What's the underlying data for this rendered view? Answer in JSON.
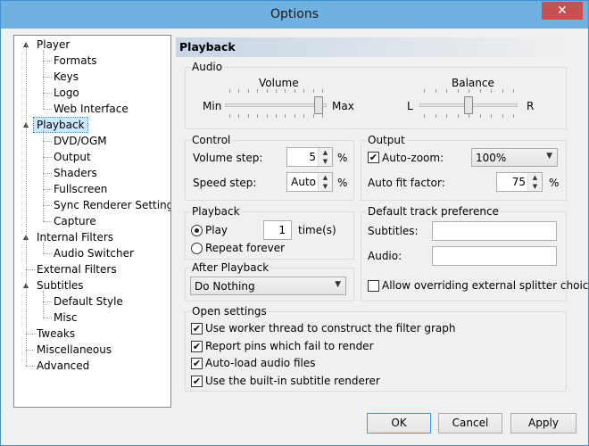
{
  "window": {
    "title": "Options",
    "close_glyph": "✕"
  },
  "tree": [
    {
      "label": "Player",
      "level": 0,
      "toggle": "▲"
    },
    {
      "label": "Formats",
      "level": 1
    },
    {
      "label": "Keys",
      "level": 1
    },
    {
      "label": "Logo",
      "level": 1
    },
    {
      "label": "Web Interface",
      "level": 1
    },
    {
      "label": "Playback",
      "level": 0,
      "toggle": "▲",
      "selected": true
    },
    {
      "label": "DVD/OGM",
      "level": 1
    },
    {
      "label": "Output",
      "level": 1
    },
    {
      "label": "Shaders",
      "level": 1
    },
    {
      "label": "Fullscreen",
      "level": 1
    },
    {
      "label": "Sync Renderer Settings",
      "level": 1
    },
    {
      "label": "Capture",
      "level": 1
    },
    {
      "label": "Internal Filters",
      "level": 0,
      "toggle": "▲"
    },
    {
      "label": "Audio Switcher",
      "level": 1
    },
    {
      "label": "External Filters",
      "level": 0
    },
    {
      "label": "Subtitles",
      "level": 0,
      "toggle": "▲"
    },
    {
      "label": "Default Style",
      "level": 1
    },
    {
      "label": "Misc",
      "level": 1
    },
    {
      "label": "Tweaks",
      "level": 0
    },
    {
      "label": "Miscellaneous",
      "level": 0
    },
    {
      "label": "Advanced",
      "level": 0
    }
  ],
  "page": {
    "title": "Playback"
  },
  "audio": {
    "label": "Audio",
    "volume_label": "Volume",
    "min": "Min",
    "max": "Max",
    "volume_value": 0.96,
    "balance_label": "Balance",
    "left": "L",
    "right": "R",
    "balance_value": 0.5
  },
  "control": {
    "label": "Control",
    "volume_step_label": "Volume step:",
    "volume_step": "5",
    "speed_step_label": "Speed step:",
    "speed_step": "Auto",
    "percent": "%"
  },
  "output": {
    "label": "Output",
    "autozoom_label": "Auto-zoom:",
    "autozoom_checked": true,
    "autozoom_value": "100%",
    "autofit_label": "Auto fit factor:",
    "autofit_value": "75",
    "percent": "%"
  },
  "playback": {
    "label": "Playback",
    "play_label": "Play",
    "play_count": "1",
    "times_label": "time(s)",
    "repeat_label": "Repeat forever"
  },
  "after": {
    "label": "After Playback",
    "value": "Do Nothing"
  },
  "track": {
    "label": "Default track preference",
    "subtitles_label": "Subtitles:",
    "audio_label": "Audio:",
    "allow_label": "Allow overriding external splitter choice"
  },
  "open": {
    "label": "Open settings",
    "items": [
      "Use worker thread to construct the filter graph",
      "Report pins which fail to render",
      "Auto-load audio files",
      "Use the built-in subtitle renderer"
    ]
  },
  "buttons": {
    "ok": "OK",
    "cancel": "Cancel",
    "apply": "Apply"
  },
  "icons": {
    "spin_up": "▲",
    "spin_down": "▼",
    "dropdown": "▼",
    "check": "✔"
  },
  "colors": {
    "titlebar": "#6fb1e0",
    "close": "#c75050",
    "selection": "#cce8ff"
  }
}
